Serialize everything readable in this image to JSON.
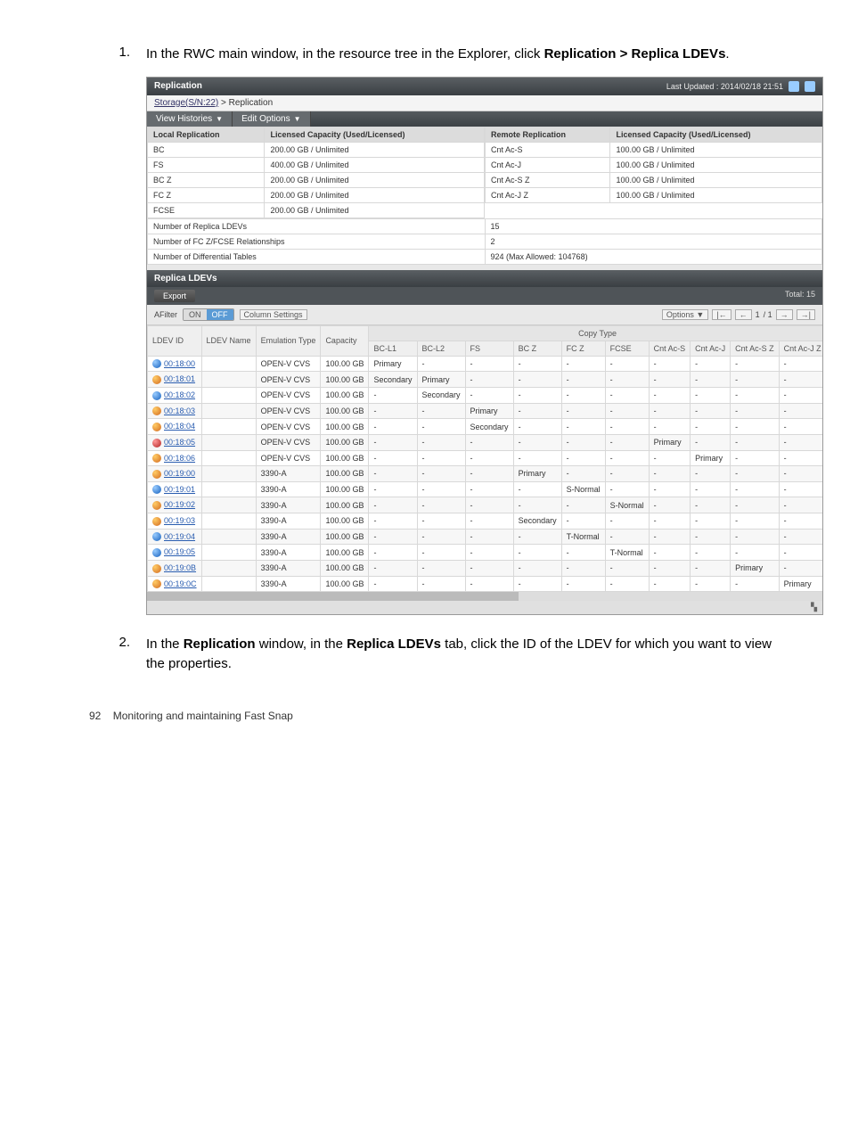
{
  "steps": [
    {
      "num": "1.",
      "pre": "In the RWC main window, in the resource tree in the Explorer, click ",
      "bold": "Replication > Replica LDEVs",
      "post": "."
    },
    {
      "num": "2.",
      "pre": "In the ",
      "bold1": "Replication",
      "mid1": " window, in the ",
      "bold2": "Replica LDEVs",
      "mid2": " tab, click the ID of the LDEV for which you want to view the properties.",
      "post": ""
    }
  ],
  "panel": {
    "title": "Replication",
    "updated": "Last Updated : 2014/02/18 21:51",
    "breadcrumb": {
      "root": "Storage(S/N:22)",
      "sep": " > ",
      "cur": "Replication"
    },
    "toolbar": {
      "view": "View Histories",
      "edit": "Edit Options"
    }
  },
  "info": {
    "local_hdr": "Local Replication",
    "remote_hdr": "Remote Replication",
    "cap_hdr": "Licensed Capacity (Used/Licensed)",
    "rows": [
      {
        "l": "BC",
        "lv": "200.00 GB / Unlimited",
        "r": "Cnt Ac-S",
        "rv": "100.00 GB / Unlimited"
      },
      {
        "l": "FS",
        "lv": "400.00 GB / Unlimited",
        "r": "Cnt Ac-J",
        "rv": "100.00 GB / Unlimited"
      },
      {
        "l": "BC Z",
        "lv": "200.00 GB / Unlimited",
        "r": "Cnt Ac-S Z",
        "rv": "100.00 GB / Unlimited"
      },
      {
        "l": "FC Z",
        "lv": "200.00 GB / Unlimited",
        "r": "Cnt Ac-J Z",
        "rv": "100.00 GB / Unlimited"
      },
      {
        "l": "FCSE",
        "lv": "200.00 GB / Unlimited",
        "r": "",
        "rv": ""
      }
    ],
    "wide": [
      {
        "label": "Number of Replica LDEVs",
        "value": "15"
      },
      {
        "label": "Number of FC Z/FCSE Relationships",
        "value": "2"
      },
      {
        "label": "Number of Differential Tables",
        "value": "924 (Max Allowed: 104768)"
      }
    ]
  },
  "tab": {
    "title": "Replica LDEVs",
    "total_label": "Total:",
    "total_value": "15"
  },
  "subtool": {
    "export": "Export",
    "filter": "AFilter",
    "on": "ON",
    "off": "OFF",
    "col": "Column Settings",
    "options": "Options",
    "page": "1",
    "of": "/ 1"
  },
  "cols": {
    "ldev": "LDEV ID",
    "name": "LDEV Name",
    "emu": "Emulation Type",
    "cap": "Capacity",
    "copy_group": "Copy Type",
    "bcl1": "BC-L1",
    "bcl2": "BC-L2",
    "fs": "FS",
    "bcz": "BC Z",
    "fcz": "FC Z",
    "fcse": "FCSE",
    "cas": "Cnt Ac-S",
    "caj": "Cnt Ac-J",
    "casz": "Cnt Ac-S Z",
    "cajz": "Cnt Ac-J Z"
  },
  "rows": [
    {
      "orb": "blue",
      "id": "00:18:00",
      "emu": "OPEN-V CVS",
      "cap": "100.00 GB",
      "bcl1": "Primary",
      "bcl2": "-",
      "fs": "-",
      "bcz": "-",
      "fcz": "-",
      "fcse": "-",
      "cas": "-",
      "caj": "-",
      "casz": "-",
      "cajz": "-"
    },
    {
      "orb": "orange",
      "id": "00:18:01",
      "emu": "OPEN-V CVS",
      "cap": "100.00 GB",
      "bcl1": "Secondary",
      "bcl2": "Primary",
      "fs": "-",
      "bcz": "-",
      "fcz": "-",
      "fcse": "-",
      "cas": "-",
      "caj": "-",
      "casz": "-",
      "cajz": "-"
    },
    {
      "orb": "blue",
      "id": "00:18:02",
      "emu": "OPEN-V CVS",
      "cap": "100.00 GB",
      "bcl1": "-",
      "bcl2": "Secondary",
      "fs": "-",
      "bcz": "-",
      "fcz": "-",
      "fcse": "-",
      "cas": "-",
      "caj": "-",
      "casz": "-",
      "cajz": "-"
    },
    {
      "orb": "orange",
      "id": "00:18:03",
      "emu": "OPEN-V CVS",
      "cap": "100.00 GB",
      "bcl1": "-",
      "bcl2": "-",
      "fs": "Primary",
      "bcz": "-",
      "fcz": "-",
      "fcse": "-",
      "cas": "-",
      "caj": "-",
      "casz": "-",
      "cajz": "-"
    },
    {
      "orb": "orange",
      "id": "00:18:04",
      "emu": "OPEN-V CVS",
      "cap": "100.00 GB",
      "bcl1": "-",
      "bcl2": "-",
      "fs": "Secondary",
      "bcz": "-",
      "fcz": "-",
      "fcse": "-",
      "cas": "-",
      "caj": "-",
      "casz": "-",
      "cajz": "-"
    },
    {
      "orb": "red",
      "id": "00:18:05",
      "emu": "OPEN-V CVS",
      "cap": "100.00 GB",
      "bcl1": "-",
      "bcl2": "-",
      "fs": "-",
      "bcz": "-",
      "fcz": "-",
      "fcse": "-",
      "cas": "Primary",
      "caj": "-",
      "casz": "-",
      "cajz": "-"
    },
    {
      "orb": "orange",
      "id": "00:18:06",
      "emu": "OPEN-V CVS",
      "cap": "100.00 GB",
      "bcl1": "-",
      "bcl2": "-",
      "fs": "-",
      "bcz": "-",
      "fcz": "-",
      "fcse": "-",
      "cas": "-",
      "caj": "Primary",
      "casz": "-",
      "cajz": "-"
    },
    {
      "orb": "orange",
      "id": "00:19:00",
      "emu": "3390-A",
      "cap": "100.00 GB",
      "bcl1": "-",
      "bcl2": "-",
      "fs": "-",
      "bcz": "Primary",
      "fcz": "-",
      "fcse": "-",
      "cas": "-",
      "caj": "-",
      "casz": "-",
      "cajz": "-"
    },
    {
      "orb": "blue",
      "id": "00:19:01",
      "emu": "3390-A",
      "cap": "100.00 GB",
      "bcl1": "-",
      "bcl2": "-",
      "fs": "-",
      "bcz": "-",
      "fcz": "S-Normal",
      "fcse": "-",
      "cas": "-",
      "caj": "-",
      "casz": "-",
      "cajz": "-"
    },
    {
      "orb": "orange",
      "id": "00:19:02",
      "emu": "3390-A",
      "cap": "100.00 GB",
      "bcl1": "-",
      "bcl2": "-",
      "fs": "-",
      "bcz": "-",
      "fcz": "-",
      "fcse": "S-Normal",
      "cas": "-",
      "caj": "-",
      "casz": "-",
      "cajz": "-"
    },
    {
      "orb": "orange",
      "id": "00:19:03",
      "emu": "3390-A",
      "cap": "100.00 GB",
      "bcl1": "-",
      "bcl2": "-",
      "fs": "-",
      "bcz": "Secondary",
      "fcz": "-",
      "fcse": "-",
      "cas": "-",
      "caj": "-",
      "casz": "-",
      "cajz": "-"
    },
    {
      "orb": "blue",
      "id": "00:19:04",
      "emu": "3390-A",
      "cap": "100.00 GB",
      "bcl1": "-",
      "bcl2": "-",
      "fs": "-",
      "bcz": "-",
      "fcz": "T-Normal",
      "fcse": "-",
      "cas": "-",
      "caj": "-",
      "casz": "-",
      "cajz": "-"
    },
    {
      "orb": "blue",
      "id": "00:19:05",
      "emu": "3390-A",
      "cap": "100.00 GB",
      "bcl1": "-",
      "bcl2": "-",
      "fs": "-",
      "bcz": "-",
      "fcz": "-",
      "fcse": "T-Normal",
      "cas": "-",
      "caj": "-",
      "casz": "-",
      "cajz": "-"
    },
    {
      "orb": "orange",
      "id": "00:19:0B",
      "emu": "3390-A",
      "cap": "100.00 GB",
      "bcl1": "-",
      "bcl2": "-",
      "fs": "-",
      "bcz": "-",
      "fcz": "-",
      "fcse": "-",
      "cas": "-",
      "caj": "-",
      "casz": "Primary",
      "cajz": "-"
    },
    {
      "orb": "orange",
      "id": "00:19:0C",
      "emu": "3390-A",
      "cap": "100.00 GB",
      "bcl1": "-",
      "bcl2": "-",
      "fs": "-",
      "bcz": "-",
      "fcz": "-",
      "fcse": "-",
      "cas": "-",
      "caj": "-",
      "casz": "-",
      "cajz": "Primary"
    }
  ],
  "footer": {
    "page": "92",
    "title": "Monitoring and maintaining Fast Snap"
  }
}
